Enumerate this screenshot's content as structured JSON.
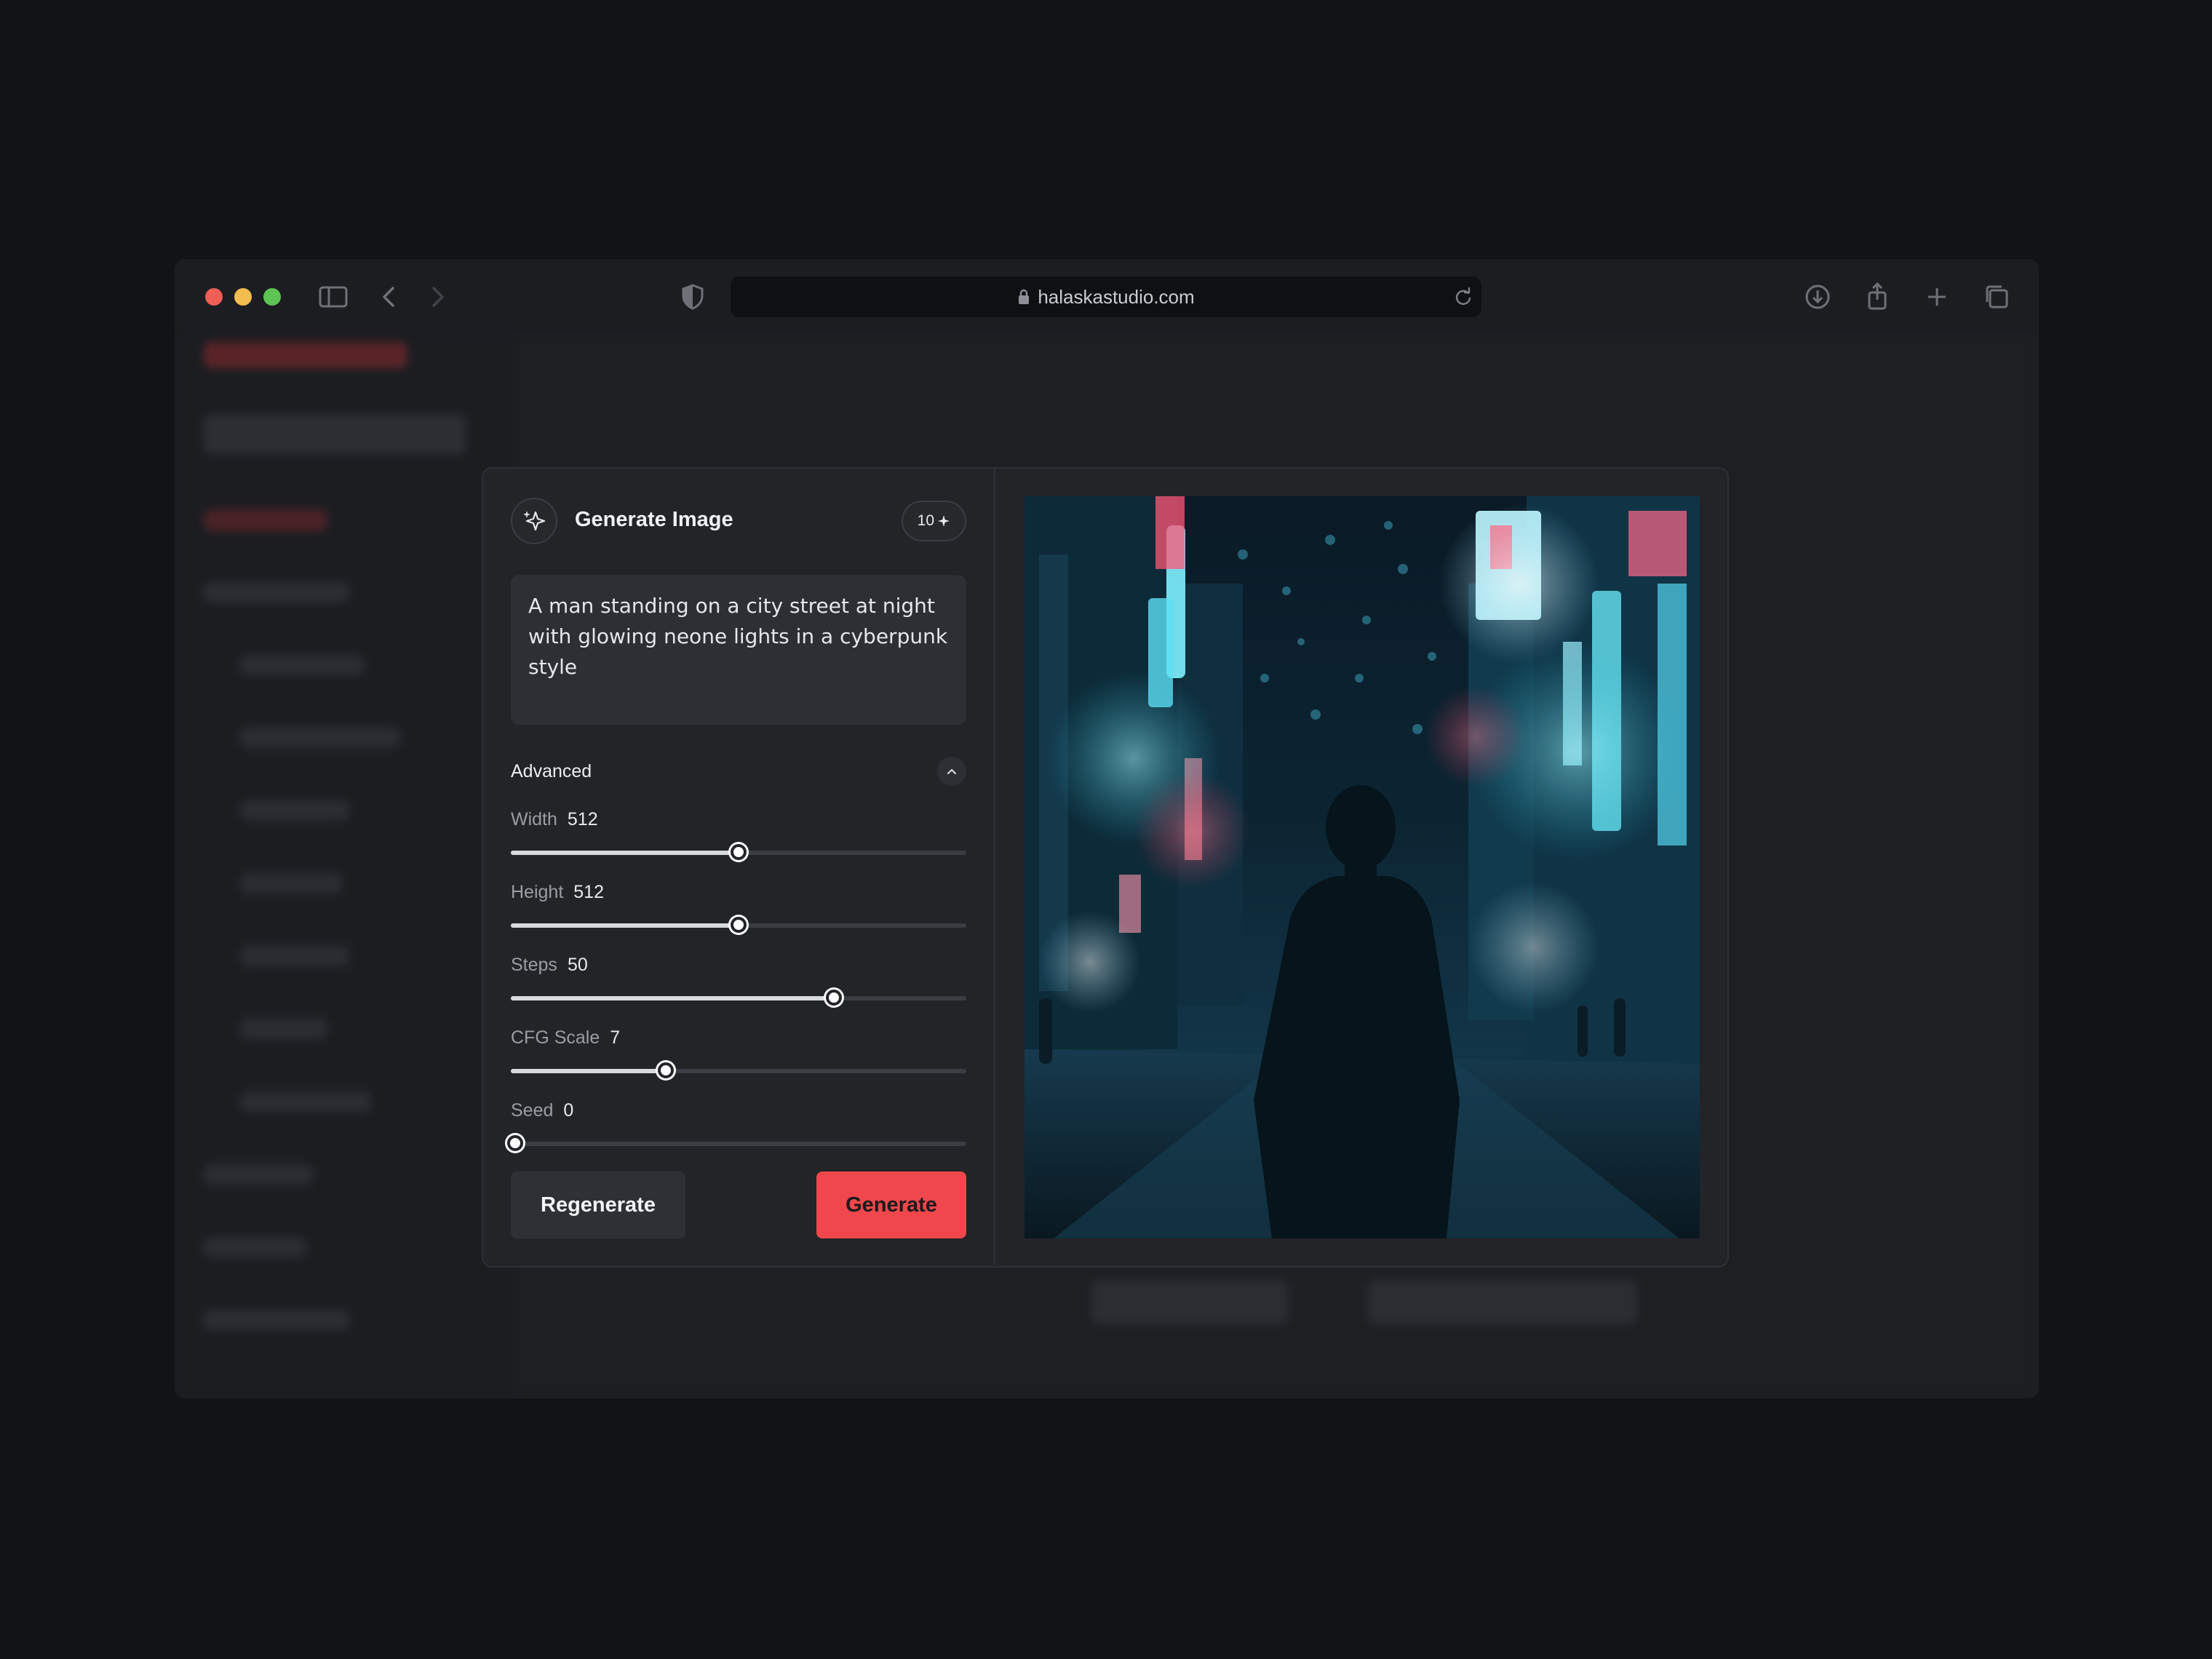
{
  "browser": {
    "url": "halaskastudio.com",
    "icons": [
      "sidebar-icon",
      "back-icon",
      "forward-icon",
      "shield-icon",
      "lock-icon",
      "reload-icon",
      "download-icon",
      "share-icon",
      "new-tab-icon",
      "tabs-overview-icon"
    ]
  },
  "modal": {
    "title": "Generate Image",
    "credits": "10",
    "prompt": "A man standing on a city street at night with glowing neone lights in a cyberpunk style",
    "advanced_label": "Advanced",
    "sliders": [
      {
        "label": "Width",
        "value": "512",
        "fraction": 0.5
      },
      {
        "label": "Height",
        "value": "512",
        "fraction": 0.5
      },
      {
        "label": "Steps",
        "value": "50",
        "fraction": 0.71
      },
      {
        "label": "CFG Scale",
        "value": "7",
        "fraction": 0.34
      },
      {
        "label": "Seed",
        "value": "0",
        "fraction": 0.0
      }
    ],
    "regenerate_label": "Regenerate",
    "generate_label": "Generate",
    "accent_color": "#f0474c"
  }
}
